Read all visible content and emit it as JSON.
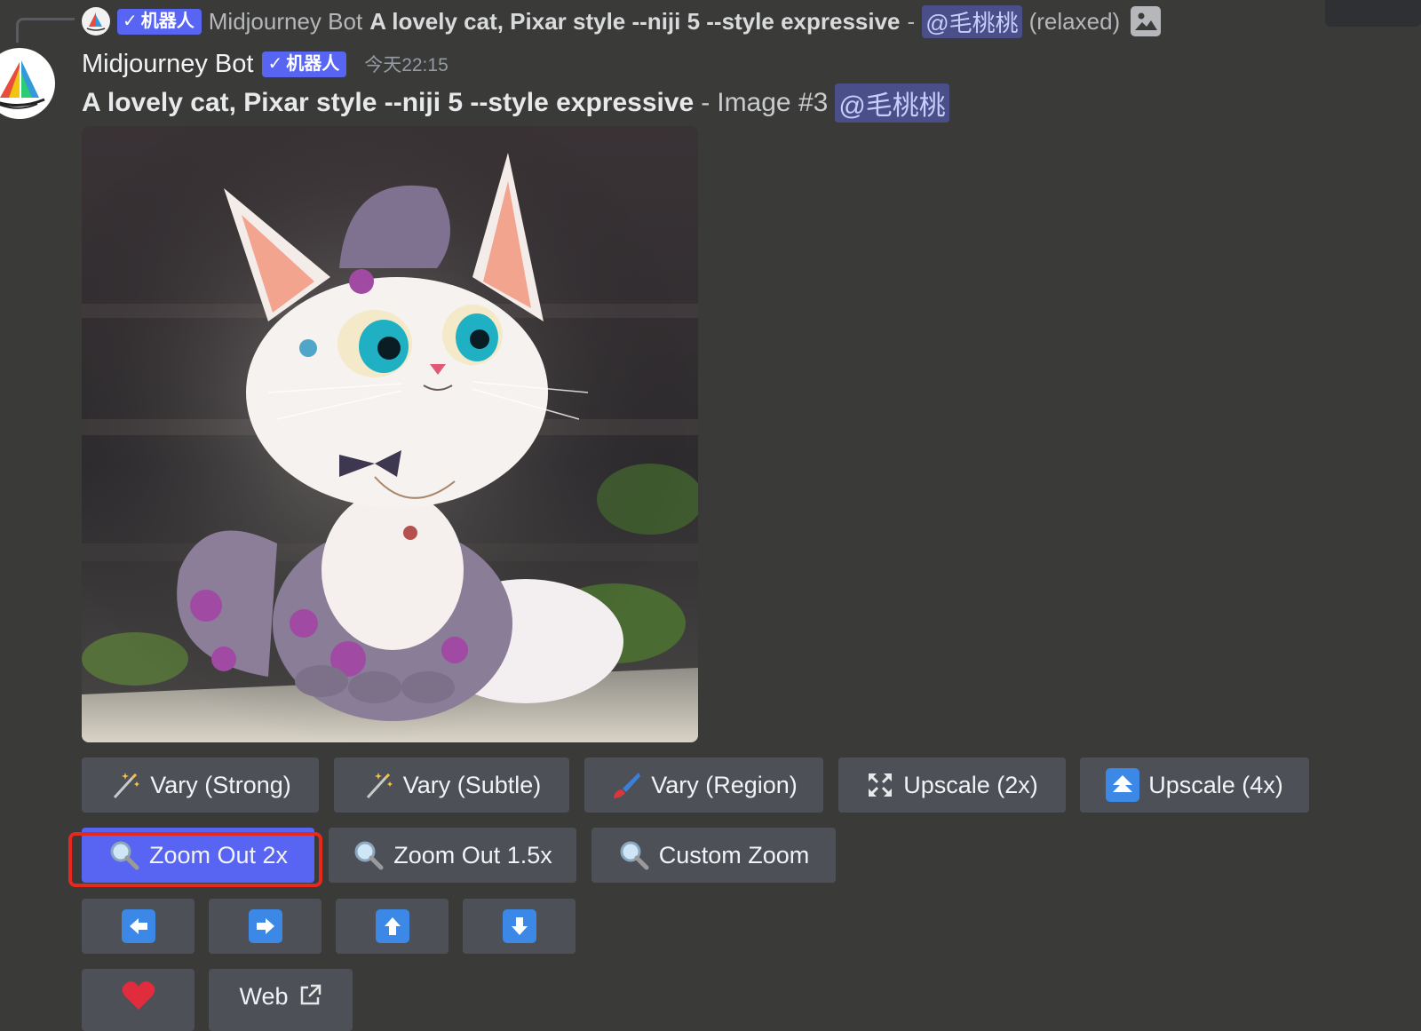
{
  "reply": {
    "bot_name": "Midjourney Bot",
    "bot_tag": "机器人",
    "prompt": "A lovely cat, Pixar style --niji 5 --style expressive",
    "separator": "-",
    "mention": "@毛桃桃",
    "mode": "(relaxed)",
    "image_icon": "image-icon"
  },
  "message": {
    "username": "Midjourney Bot",
    "bot_tag": "机器人",
    "timestamp": "今天22:15",
    "prompt": "A lovely cat, Pixar style --niji 5 --style expressive",
    "separator": "-",
    "image_label": "Image #3",
    "mention": "@毛桃桃",
    "image_description": "cat-image"
  },
  "buttons": {
    "row1": [
      {
        "label": "Vary (Strong)",
        "icon": "magic-wand-icon"
      },
      {
        "label": "Vary (Subtle)",
        "icon": "magic-wand-icon"
      },
      {
        "label": "Vary (Region)",
        "icon": "paintbrush-icon"
      },
      {
        "label": "Upscale (2x)",
        "icon": "expand-icon"
      },
      {
        "label": "Upscale (4x)",
        "icon": "double-up-arrow-icon"
      }
    ],
    "row2": [
      {
        "label": "Zoom Out 2x",
        "icon": "magnifier-icon",
        "selected": true
      },
      {
        "label": "Zoom Out 1.5x",
        "icon": "magnifier-icon"
      },
      {
        "label": "Custom Zoom",
        "icon": "magnifier-icon"
      }
    ],
    "row3": [
      {
        "icon": "arrow-left-icon"
      },
      {
        "icon": "arrow-right-icon"
      },
      {
        "icon": "arrow-up-icon"
      },
      {
        "icon": "arrow-down-icon"
      }
    ],
    "row4": [
      {
        "icon": "heart-icon"
      },
      {
        "label": "Web",
        "icon": "external-link-icon"
      }
    ]
  },
  "colors": {
    "background": "#3a3a38",
    "button": "#4e5058",
    "primary": "#5865f2",
    "highlight": "#e8281f",
    "arrow": "#3b88e6"
  }
}
